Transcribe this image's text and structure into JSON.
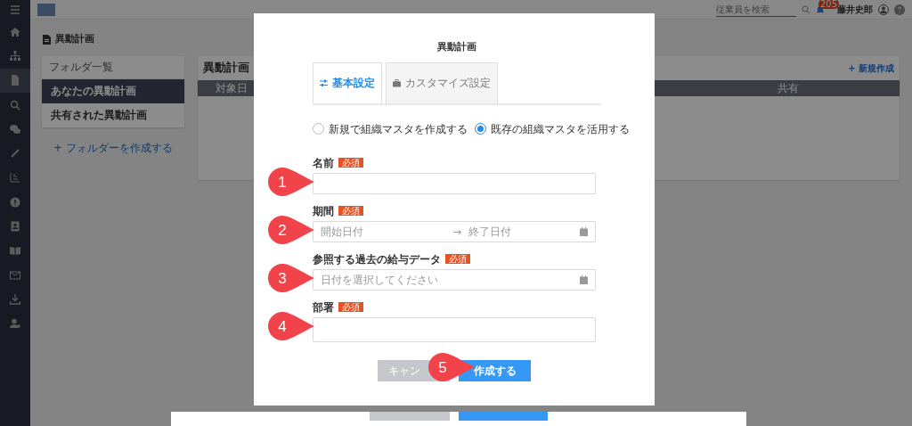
{
  "sidebar": {
    "items": [
      {
        "kind": "menu",
        "selected": false
      },
      {
        "kind": "home",
        "selected": false
      },
      {
        "kind": "org",
        "selected": false
      },
      {
        "kind": "document",
        "selected": true
      },
      {
        "kind": "search",
        "selected": false
      },
      {
        "kind": "chat",
        "selected": false
      },
      {
        "kind": "link",
        "selected": false
      },
      {
        "kind": "chart",
        "selected": false
      },
      {
        "kind": "info",
        "selected": false
      },
      {
        "kind": "contact",
        "selected": false
      },
      {
        "kind": "book",
        "selected": false
      },
      {
        "kind": "mail",
        "selected": false
      },
      {
        "kind": "download",
        "selected": false
      },
      {
        "kind": "user",
        "selected": false
      }
    ]
  },
  "topbar": {
    "search": {
      "placeholder": "従業員を検索"
    },
    "notifications": "205",
    "user": "藤井史郎"
  },
  "page": {
    "title": "異動計画",
    "folders": {
      "header": "フォルダ一覧",
      "items": [
        {
          "label": "あなたの異動計画",
          "selected": true
        },
        {
          "label": "共有された異動計画",
          "selected": false
        }
      ],
      "create_link": "+ フォルダーを作成する"
    },
    "list": {
      "title": "異動計画",
      "new_link": "+ 新規作成",
      "columns": [
        "対象日",
        "共有"
      ]
    }
  },
  "modal": {
    "title": "異動計画",
    "tabs": [
      {
        "label": "基本設定",
        "kind": "sliders",
        "selected": true
      },
      {
        "label": "カスタマイズ設定",
        "kind": "briefcase",
        "selected": false
      }
    ],
    "radios": [
      {
        "label": "新規で組織マスタを作成する",
        "selected": false
      },
      {
        "label": "既存の組織マスタを活用する",
        "selected": true
      }
    ],
    "fields": [
      {
        "label": "名前",
        "required": "必須",
        "kind": "text",
        "callout": "1"
      },
      {
        "label": "期間",
        "required": "必須",
        "kind": "range",
        "start_placeholder": "開始日付",
        "arrow": "→",
        "end_placeholder": "終了日付",
        "callout": "2"
      },
      {
        "label": "参照する過去の給与データ",
        "required": "必須",
        "kind": "date",
        "placeholder": "日付を選択してください",
        "callout": "3"
      },
      {
        "label": "部署",
        "required": "必須",
        "kind": "select",
        "callout": "4"
      }
    ],
    "buttons": {
      "cancel": "キャン",
      "submit": "作成する",
      "callout": "5"
    }
  }
}
